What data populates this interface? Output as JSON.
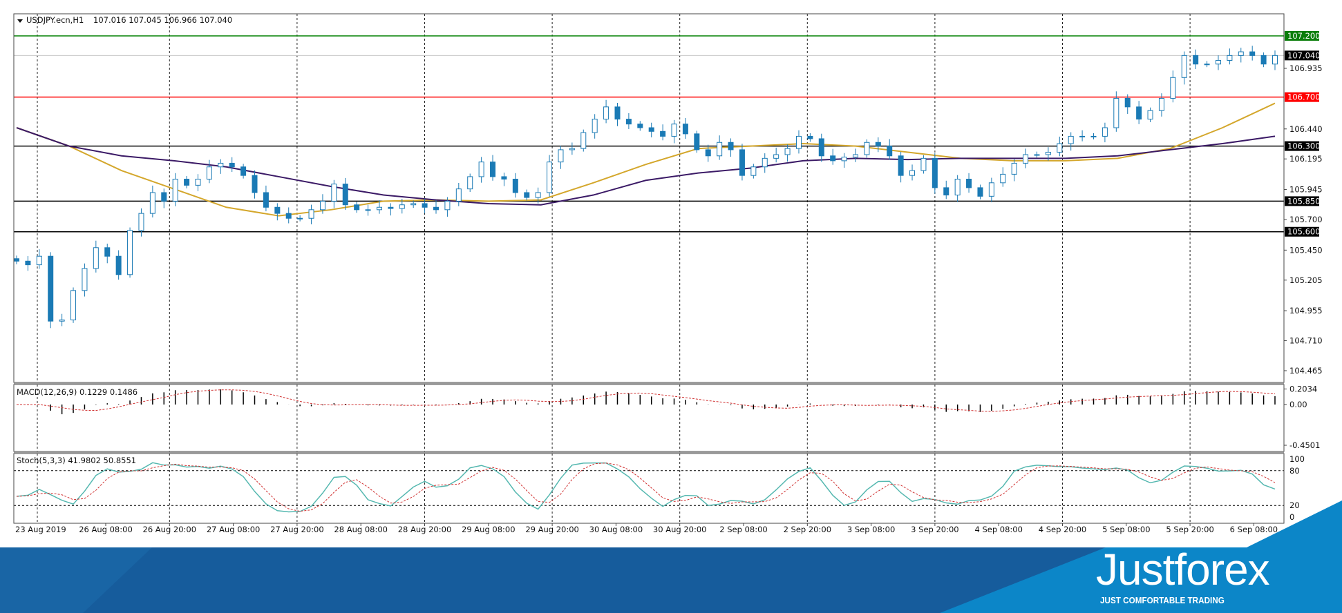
{
  "chart_data": {
    "type": "candlestick",
    "title": "USDJPY.ecn,H1",
    "ohlc_readout": "107.016 107.045 106.966 107.040",
    "price_ticks": [
      "106.935",
      "106.440",
      "106.195",
      "105.945",
      "105.700",
      "105.450",
      "105.205",
      "104.955",
      "104.710",
      "104.465"
    ],
    "ylim": [
      104.39,
      107.35
    ],
    "levels": [
      {
        "value": "107.200",
        "color": "#008000",
        "label_bg": "#0a7d0a"
      },
      {
        "value": "106.700",
        "color": "#ff0000",
        "label_bg": "#ff0000"
      },
      {
        "value": "106.300",
        "color": "#000000",
        "label_bg": "#000000"
      },
      {
        "value": "105.850",
        "color": "#000000",
        "label_bg": "#000000"
      },
      {
        "value": "105.600",
        "color": "#000000",
        "label_bg": "#000000"
      }
    ],
    "current_price": "107.040",
    "close": [
      105.36,
      105.33,
      105.4,
      104.87,
      104.88,
      105.12,
      105.3,
      105.47,
      105.4,
      105.25,
      105.61,
      105.75,
      105.92,
      105.85,
      106.03,
      105.98,
      106.03,
      106.13,
      106.16,
      106.13,
      106.06,
      105.92,
      105.8,
      105.75,
      105.71,
      105.71,
      105.78,
      105.85,
      105.99,
      105.82,
      105.78,
      105.78,
      105.8,
      105.79,
      105.82,
      105.83,
      105.8,
      105.78,
      105.85,
      105.95,
      106.05,
      106.17,
      106.05,
      106.03,
      105.92,
      105.88,
      105.92,
      106.17,
      106.27,
      106.28,
      106.41,
      106.52,
      106.62,
      106.52,
      106.48,
      106.45,
      106.42,
      106.38,
      106.48,
      106.4,
      106.27,
      106.22,
      106.33,
      106.27,
      106.06,
      106.13,
      106.2,
      106.23,
      106.28,
      106.38,
      106.36,
      106.22,
      106.18,
      106.21,
      106.23,
      106.33,
      106.3,
      106.22,
      106.06,
      106.1,
      106.2,
      105.96,
      105.9,
      106.03,
      105.96,
      105.89,
      106.0,
      106.07,
      106.16,
      106.23,
      106.23,
      106.25,
      106.32,
      106.38,
      106.38,
      106.38,
      106.45,
      106.69,
      106.62,
      106.52,
      106.59,
      106.69,
      106.86,
      107.04,
      106.97,
      106.97,
      107.0,
      107.04,
      107.07,
      107.04,
      106.97,
      107.04
    ],
    "ma_yellow": [
      106.45,
      106.3,
      106.1,
      105.95,
      105.8,
      105.73,
      105.78,
      105.85,
      105.86,
      105.85,
      105.86,
      106.0,
      106.15,
      106.28,
      106.3,
      106.32,
      106.3,
      106.25,
      106.2,
      106.18,
      106.18,
      106.2,
      106.28,
      106.45,
      106.65
    ],
    "ma_purple": [
      106.45,
      106.3,
      106.22,
      106.18,
      106.13,
      106.05,
      105.97,
      105.9,
      105.86,
      105.83,
      105.82,
      105.9,
      106.02,
      106.08,
      106.12,
      106.18,
      106.2,
      106.19,
      106.2,
      106.2,
      106.2,
      106.22,
      106.27,
      106.32,
      106.38
    ],
    "up_color": "#ffffff",
    "down_color": "#1a7ab5",
    "candle_outline": "#1a7ab5",
    "ma_yellow_color": "#d4a72c",
    "ma_purple_color": "#3b1a66",
    "macd": {
      "label": "MACD(12,26,9) 0.1229 0.1486",
      "ticks": [
        "0.2034",
        "0.00",
        "-0.4501"
      ],
      "ylim": [
        -0.4501,
        0.2034
      ],
      "signal_color": "#d03030"
    },
    "stoch": {
      "label": "Stoch(5,3,3) 41.9802 50.8551",
      "ticks": [
        "100",
        "80",
        "20",
        "0"
      ],
      "main_color": "#55b8b0",
      "signal_color": "#d03030"
    },
    "time_labels": [
      "23 Aug 2019",
      "26 Aug 08:00",
      "26 Aug 20:00",
      "27 Aug 08:00",
      "27 Aug 20:00",
      "28 Aug 08:00",
      "28 Aug 20:00",
      "29 Aug 08:00",
      "29 Aug 20:00",
      "30 Aug 08:00",
      "30 Aug 20:00",
      "2 Sep 08:00",
      "2 Sep 20:00",
      "3 Sep 08:00",
      "3 Sep 20:00",
      "4 Sep 08:00",
      "4 Sep 20:00",
      "5 Sep 08:00",
      "5 Sep 20:00",
      "6 Sep 08:00"
    ],
    "grid": "vertical dashed"
  },
  "brand": {
    "logo": "Justforex",
    "tagline": "JUST COMFORTABLE TRADING",
    "dark_blue": "#165c9c",
    "light_blue": "#0c86c8"
  }
}
